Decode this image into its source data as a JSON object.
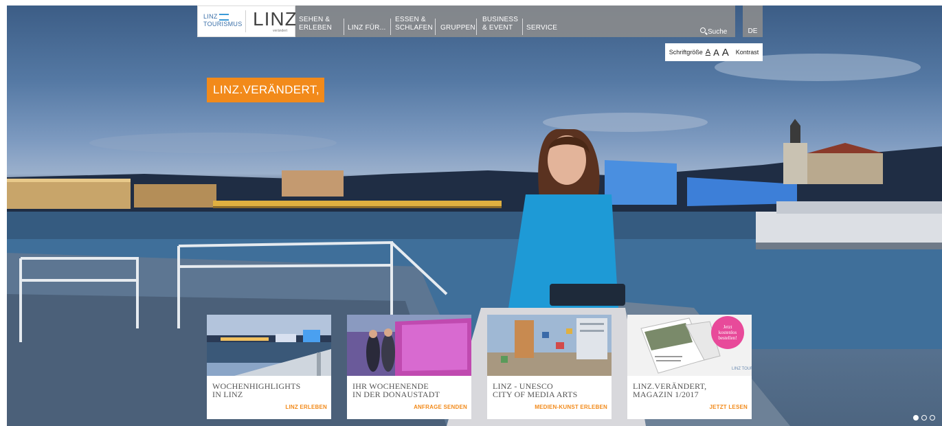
{
  "logo": {
    "tourismus_line1": "LINZ",
    "tourismus_line2": "TOURISMUS",
    "wordmark": "LINZ",
    "wordmark_sub": "verändert"
  },
  "nav": {
    "items": [
      {
        "label": "SEHEN &\nERLEBEN"
      },
      {
        "label": "LINZ FÜR..."
      },
      {
        "label": "ESSEN &\nSCHLAFEN"
      },
      {
        "label": "GRUPPEN"
      },
      {
        "label": "BUSINESS\n& EVENT"
      },
      {
        "label": "SERVICE"
      }
    ],
    "search_label": "Suche",
    "language": "DE"
  },
  "accessibility": {
    "font_size_label": "Schriftgröße",
    "size_small": "A",
    "size_medium": "A",
    "size_large": "A",
    "contrast_label": "Kontrast"
  },
  "hero": {
    "claim": "LINZ.VERÄNDERT,"
  },
  "cards": [
    {
      "title_line1": "WOCHENHIGHLIGHTS",
      "title_line2": "IN LINZ",
      "cta": "LINZ ERLEBEN"
    },
    {
      "title_line1": "IHR WOCHENENDE",
      "title_line2": "IN DER DONAUSTADT",
      "cta": "ANFRAGE SENDEN"
    },
    {
      "title_line1": "LINZ - UNESCO",
      "title_line2": "CITY OF MEDIA ARTS",
      "cta": "MEDIEN-KUNST ERLEBEN"
    },
    {
      "title_line1": "LINZ.VERÄNDERT,",
      "title_line2": "MAGAZIN 1/2017",
      "cta": "JETZT LESEN",
      "badge": "Jetzt kostenlos bestellen!",
      "mag_logo": "LINZ TOURISMUS"
    }
  ],
  "carousel": {
    "dots": 3,
    "active": 0
  },
  "colors": {
    "accent": "#f28a1a",
    "nav_bg": "#8c8c8c",
    "river_blue": "#3f6f9a",
    "ars_blue": "#4a8fe0"
  }
}
